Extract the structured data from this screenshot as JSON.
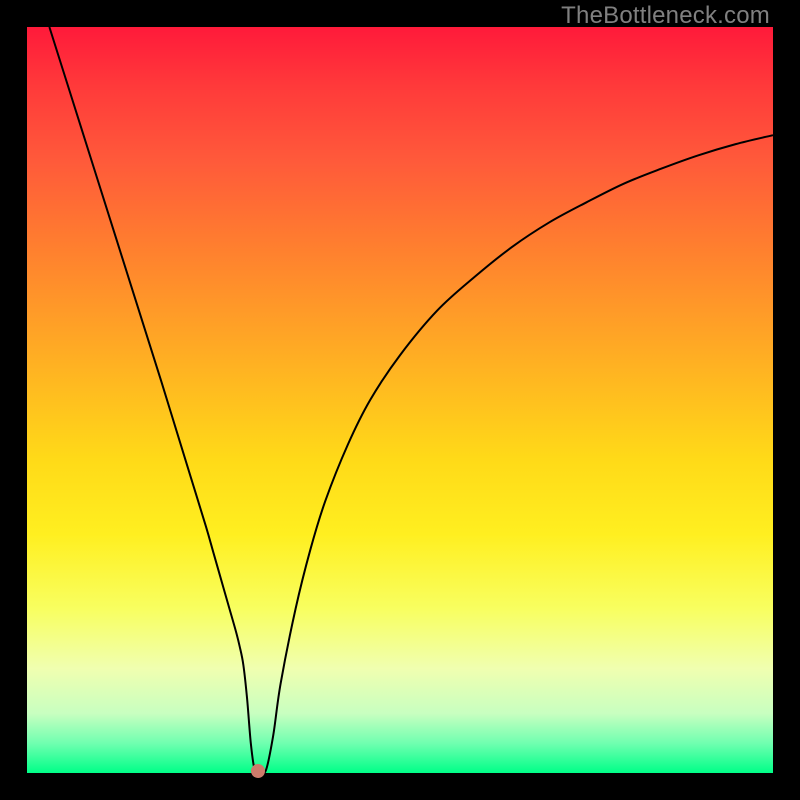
{
  "watermark": "TheBottleneck.com",
  "chart_data": {
    "type": "line",
    "title": "",
    "xlabel": "",
    "ylabel": "",
    "xlim": [
      0,
      100
    ],
    "ylim": [
      0,
      100
    ],
    "x": [
      3,
      6,
      9,
      12,
      15,
      18,
      20,
      22,
      24,
      25,
      26,
      27,
      28,
      28.5,
      29,
      29.5,
      30,
      30.5,
      31,
      32,
      33,
      34,
      36,
      38,
      40,
      43,
      46,
      50,
      55,
      60,
      65,
      70,
      75,
      80,
      85,
      90,
      95,
      100
    ],
    "values": [
      100,
      90.5,
      81,
      71.5,
      62,
      52.5,
      46,
      39.5,
      33,
      29.5,
      26,
      22.5,
      19,
      17,
      14.5,
      10,
      4,
      0.5,
      0.3,
      0.3,
      5,
      12,
      22,
      30,
      36.5,
      44,
      50,
      56,
      62,
      66.5,
      70.5,
      73.8,
      76.5,
      79,
      81,
      82.8,
      84.3,
      85.5
    ],
    "marker": {
      "x": 31,
      "y": 0.3,
      "color": "#cd7b6b"
    },
    "background_gradient": [
      "#ff1a3a",
      "#ffda18",
      "#00ff88"
    ]
  },
  "plot": {
    "frame_color": "#000000",
    "inner_left": 27,
    "inner_top": 27,
    "inner_width": 746,
    "inner_height": 746
  }
}
